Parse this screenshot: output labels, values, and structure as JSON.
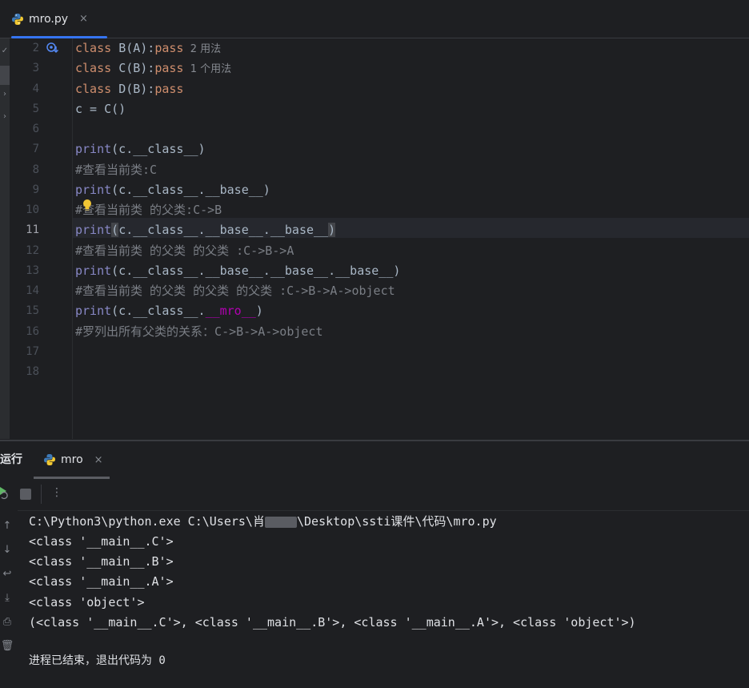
{
  "editor": {
    "tab": {
      "label": "mro.py",
      "close": "×",
      "icon": "python-icon"
    },
    "current_line": 11,
    "lines": [
      {
        "n": "2",
        "parts": [
          {
            "t": "class ",
            "c": "kw"
          },
          {
            "t": "B(A):",
            "c": "cn"
          },
          {
            "t": "pass",
            "c": "kw"
          },
          {
            "t": "  2 用法",
            "c": "hint"
          }
        ]
      },
      {
        "n": "3",
        "parts": [
          {
            "t": "class ",
            "c": "kw"
          },
          {
            "t": "C(B):",
            "c": "cn"
          },
          {
            "t": "pass",
            "c": "kw"
          },
          {
            "t": "  1 个用法",
            "c": "hint"
          }
        ]
      },
      {
        "n": "4",
        "parts": [
          {
            "t": "class ",
            "c": "kw"
          },
          {
            "t": "D(B):",
            "c": "cn"
          },
          {
            "t": "pass",
            "c": "kw"
          }
        ]
      },
      {
        "n": "5",
        "parts": [
          {
            "t": "c = C()",
            "c": "cn"
          }
        ]
      },
      {
        "n": "6",
        "parts": []
      },
      {
        "n": "7",
        "parts": [
          {
            "t": "print",
            "c": "fn"
          },
          {
            "t": "(c.__class__)",
            "c": "cn"
          }
        ]
      },
      {
        "n": "8",
        "parts": [
          {
            "t": "#查看当前类:C",
            "c": "cm"
          }
        ]
      },
      {
        "n": "9",
        "parts": [
          {
            "t": "print",
            "c": "fn"
          },
          {
            "t": "(c.__class__.__base__)",
            "c": "cn"
          }
        ]
      },
      {
        "n": "10",
        "parts": [
          {
            "t": "#查看当前类 的父类:C->B",
            "c": "cm"
          }
        ]
      },
      {
        "n": "11",
        "parts": [
          {
            "t": "print",
            "c": "fn"
          },
          {
            "t": "(",
            "c": "cn paren-hl"
          },
          {
            "t": "c.__class__.__base__.__base__",
            "c": "cn"
          },
          {
            "t": ")",
            "c": "cn paren-hl"
          }
        ]
      },
      {
        "n": "12",
        "parts": [
          {
            "t": "#查看当前类 的父类 的父类 :C->B->A",
            "c": "cm"
          }
        ]
      },
      {
        "n": "13",
        "parts": [
          {
            "t": "print",
            "c": "fn"
          },
          {
            "t": "(c.__class__.__base__.__base__.__base__)",
            "c": "cn"
          }
        ]
      },
      {
        "n": "14",
        "parts": [
          {
            "t": "#查看当前类 的父类 的父类 的父类 :C->B->A->object",
            "c": "cm"
          }
        ]
      },
      {
        "n": "15",
        "parts": [
          {
            "t": "print",
            "c": "fn"
          },
          {
            "t": "(c.__class__.",
            "c": "cn"
          },
          {
            "t": "__mro__",
            "c": "mg"
          },
          {
            "t": ")",
            "c": "cn"
          }
        ]
      },
      {
        "n": "16",
        "parts": [
          {
            "t": "#罗列出所有父类的关系：C->B->A->object",
            "c": "cm"
          }
        ]
      },
      {
        "n": "17",
        "parts": []
      },
      {
        "n": "18",
        "parts": []
      }
    ]
  },
  "run": {
    "title": "运行",
    "tab": {
      "label": "mro",
      "close": "×",
      "icon": "python-icon"
    },
    "toolbar": {
      "rerun_icon": "rerun-icon",
      "stop_icon": "stop-icon",
      "more_icon": "more-vertical-icon",
      "more": "⋮"
    },
    "console": {
      "command_prefix": "C:\\Python3\\python.exe C:\\Users\\",
      "command_user_partial": "肖",
      "command_suffix": "\\Desktop\\ssti课件\\代码\\mro.py",
      "output": [
        "<class '__main__.C'>",
        "<class '__main__.B'>",
        "<class '__main__.A'>",
        "<class 'object'>",
        "(<class '__main__.C'>, <class '__main__.B'>, <class '__main__.A'>, <class 'object'>)",
        "",
        "进程已结束，退出代码为 0"
      ]
    }
  },
  "colors": {
    "background": "#1e1f22",
    "keyword": "#cf8e6d",
    "builtin": "#8888c6",
    "magic": "#b200b2",
    "comment": "#7a7e85",
    "accent": "#3574f0"
  }
}
